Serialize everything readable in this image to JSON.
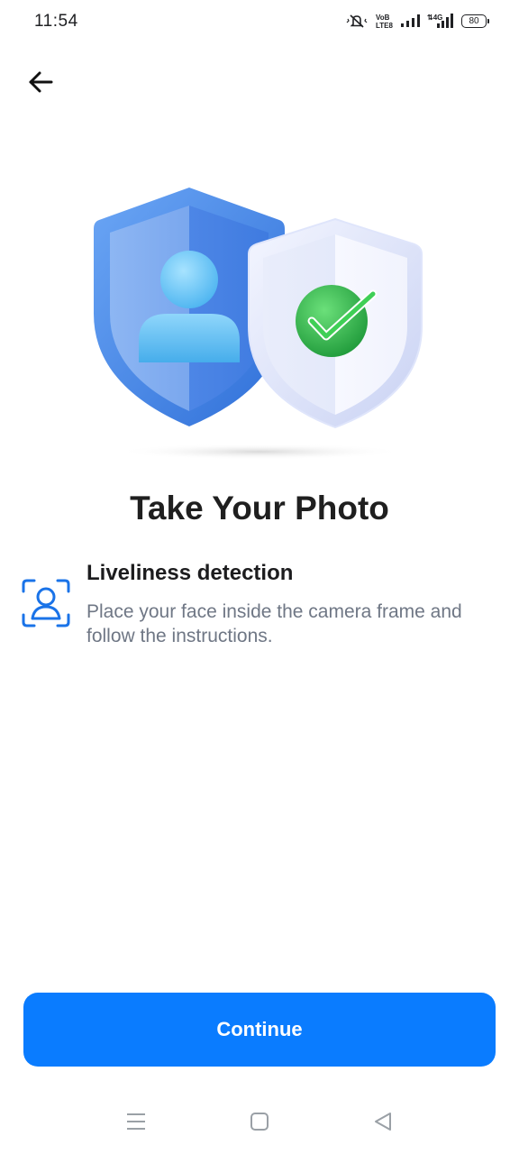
{
  "status_bar": {
    "time": "11:54",
    "battery": "80",
    "icons": [
      "mute-vibrate-icon",
      "volte-icon",
      "signal-icon",
      "4g-signal-icon",
      "battery-icon"
    ]
  },
  "nav": {
    "back_icon": "arrow-left-icon"
  },
  "hero": {
    "image": "shield-user-check-illustration"
  },
  "page": {
    "title": "Take Your Photo"
  },
  "feature": {
    "icon": "face-scan-icon",
    "title": "Liveliness detection",
    "description": "Place your face inside the camera frame and follow the instructions."
  },
  "actions": {
    "continue_label": "Continue"
  },
  "system_nav": {
    "items": [
      "menu-icon",
      "home-icon",
      "back-triangle-icon"
    ]
  },
  "colors": {
    "accent": "#0a7cff",
    "text_primary": "#1c1c1e",
    "text_secondary": "#6f7785",
    "shield_blue": "#3f7fe0",
    "check_green": "#2fb24a"
  }
}
